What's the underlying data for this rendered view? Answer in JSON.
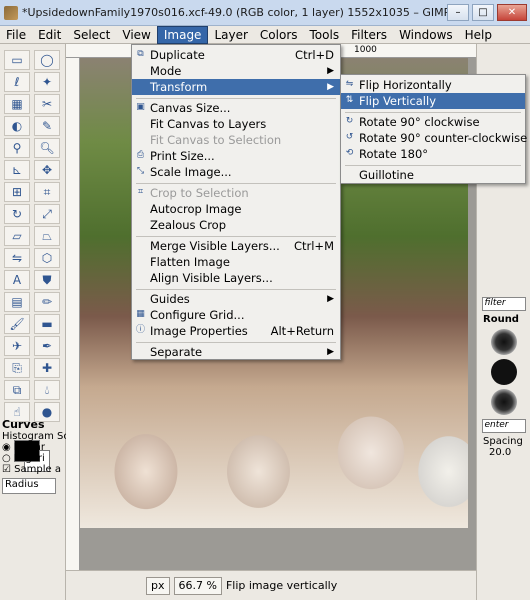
{
  "window": {
    "title": "*UpsidedownFamily1970s016.xcf-49.0 (RGB color, 1 layer) 1552x1035 – GIMP",
    "minimize": "–",
    "maximize": "□",
    "close": "✕"
  },
  "menubar": {
    "items": [
      "File",
      "Edit",
      "Select",
      "View",
      "Image",
      "Layer",
      "Colors",
      "Tools",
      "Filters",
      "Windows",
      "Help"
    ],
    "active": "Image"
  },
  "ruler": {
    "mark": "1000"
  },
  "image_menu": {
    "items": [
      {
        "label": "Duplicate",
        "shortcut": "Ctrl+D",
        "icon": "duplicate-icon"
      },
      {
        "label": "Mode",
        "submenu": true
      },
      {
        "label": "Transform",
        "submenu": true,
        "highlighted": true
      },
      {
        "label": "Canvas Size...",
        "icon": "canvas-size-icon"
      },
      {
        "label": "Fit Canvas to Layers"
      },
      {
        "label": "Fit Canvas to Selection",
        "disabled": true
      },
      {
        "label": "Print Size...",
        "icon": "print-size-icon"
      },
      {
        "label": "Scale Image...",
        "icon": "scale-image-icon"
      },
      {
        "label": "Crop to Selection",
        "disabled": true,
        "icon": "crop-icon"
      },
      {
        "label": "Autocrop Image"
      },
      {
        "label": "Zealous Crop"
      },
      {
        "label": "Merge Visible Layers...",
        "shortcut": "Ctrl+M"
      },
      {
        "label": "Flatten Image"
      },
      {
        "label": "Align Visible Layers..."
      },
      {
        "label": "Guides",
        "submenu": true
      },
      {
        "label": "Configure Grid...",
        "icon": "grid-icon"
      },
      {
        "label": "Image Properties",
        "shortcut": "Alt+Return",
        "icon": "info-icon"
      },
      {
        "label": "Separate",
        "submenu": true
      }
    ]
  },
  "transform_menu": {
    "items": [
      {
        "label": "Flip Horizontally",
        "icon": "flip-horizontal-icon"
      },
      {
        "label": "Flip Vertically",
        "icon": "flip-vertical-icon",
        "highlighted": true
      },
      {
        "label": "Rotate 90° clockwise",
        "icon": "rotate-cw-icon"
      },
      {
        "label": "Rotate 90° counter-clockwise",
        "icon": "rotate-ccw-icon"
      },
      {
        "label": "Rotate 180°",
        "icon": "rotate-180-icon"
      },
      {
        "label": "Guillotine"
      }
    ]
  },
  "toolbox": {
    "options_title": "Curves",
    "histogram_label": "Histogram Sc",
    "linear": "Linear",
    "logarithmic": "Logari",
    "sample_label": "Sample a",
    "radius_label": "Radius"
  },
  "statusbar": {
    "unit": "px",
    "zoom": "66.7 %",
    "message": "Flip image vertically"
  },
  "right_panel": {
    "filter_placeholder": "filter",
    "brush_name": "Round",
    "enter_placeholder": "enter",
    "spacing_label": "Spacing",
    "spacing_value": "20.0"
  }
}
